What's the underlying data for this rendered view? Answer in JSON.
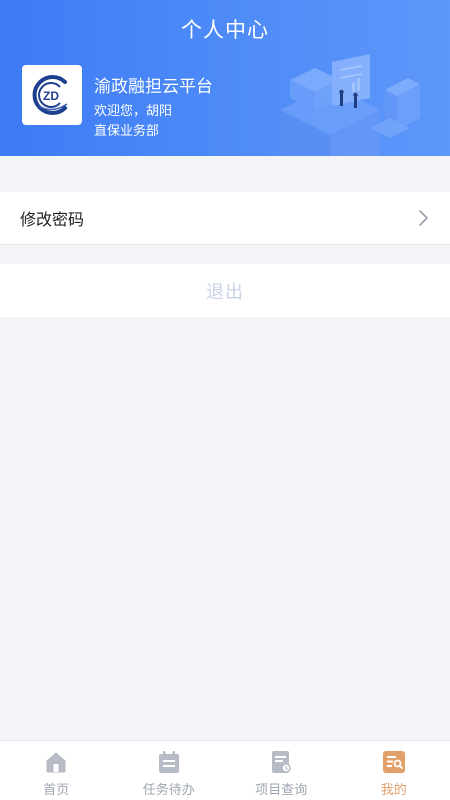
{
  "header": {
    "title": "个人中心",
    "org_name": "渝政融担云平台",
    "welcome": "欢迎您，胡阳",
    "department": "直保业务部",
    "logo_text": "ZD"
  },
  "menu": {
    "change_password": "修改密码"
  },
  "logout": {
    "label": "退出"
  },
  "tabbar": {
    "items": [
      {
        "label": "首页",
        "icon": "home-icon"
      },
      {
        "label": "任务待办",
        "icon": "calendar-icon"
      },
      {
        "label": "项目查询",
        "icon": "document-search-icon"
      },
      {
        "label": "我的",
        "icon": "profile-icon"
      }
    ],
    "active_index": 3,
    "active_color": "#e2a06a",
    "inactive_color": "#a0a5b3"
  },
  "colors": {
    "header_gradient_start": "#3d7bf5",
    "header_gradient_end": "#5e97fa",
    "background": "#f2f4f8",
    "logout_text": "#c9d3e6"
  }
}
